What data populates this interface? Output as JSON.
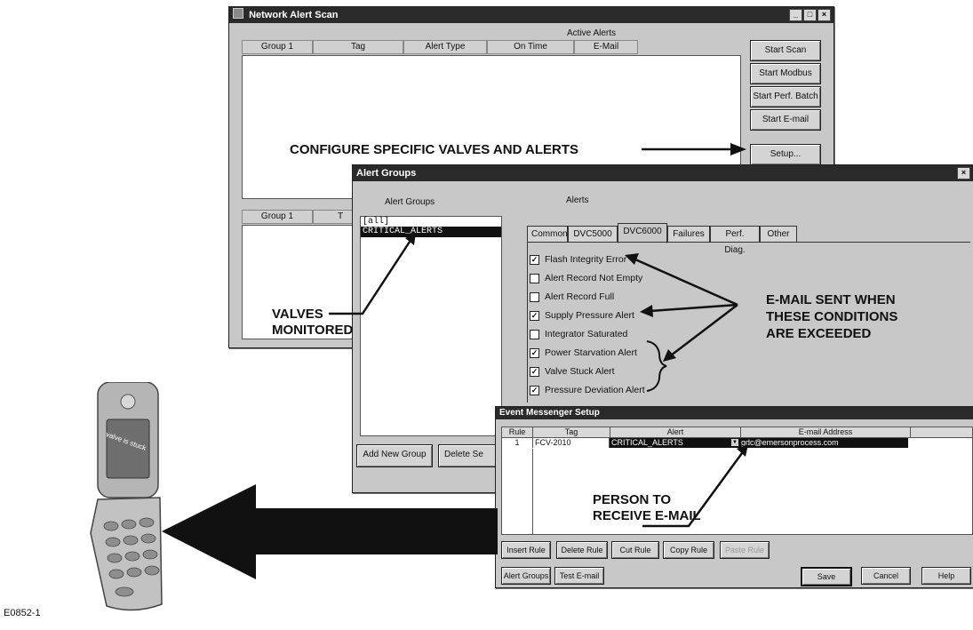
{
  "network_window": {
    "title": "Network Alert Scan",
    "section_title": "Active Alerts",
    "columns": [
      "Group 1",
      "Tag",
      "Alert Type",
      "On Time",
      "E-Mail"
    ],
    "lower_columns": [
      "Group 1",
      "T"
    ],
    "buttons": {
      "start_scan": "Start Scan",
      "start_modbus": "Start Modbus",
      "start_perf_batch": "Start Perf. Batch",
      "start_email": "Start E-mail",
      "setup": "Setup..."
    }
  },
  "alert_groups_window": {
    "title": "Alert Groups",
    "groups_label": "Alert Groups",
    "alerts_label": "Alerts",
    "groups": [
      "[all]",
      "CRITICAL_ALERTS"
    ],
    "tabs": [
      "Common",
      "DVC5000",
      "DVC6000",
      "Failures",
      "Perf. Diag.",
      "Other"
    ],
    "active_tab": "DVC6000",
    "alerts": [
      {
        "label": "Flash Integrity Error",
        "checked": true
      },
      {
        "label": "Alert Record Not Empty",
        "checked": false
      },
      {
        "label": "Alert Record Full",
        "checked": false
      },
      {
        "label": "Supply Pressure Alert",
        "checked": true
      },
      {
        "label": "Integrator Saturated",
        "checked": false
      },
      {
        "label": "Power Starvation Alert",
        "checked": true
      },
      {
        "label": "Valve Stuck Alert",
        "checked": true
      },
      {
        "label": "Pressure Deviation Alert",
        "checked": true
      }
    ],
    "buttons": {
      "add_group": "Add New Group",
      "delete_group": "Delete Se"
    }
  },
  "event_window": {
    "title": "Event Messenger Setup",
    "columns": [
      "Rule",
      "Tag",
      "Alert",
      "E-mail Address"
    ],
    "row": {
      "rule": "1",
      "tag": "FCV-2010",
      "alert": "CRITICAL_ALERTS",
      "email": "gdc@emersonprocess.com"
    },
    "buttons": {
      "insert": "Insert Rule",
      "delete": "Delete Rule",
      "cut": "Cut Rule",
      "copy": "Copy Rule",
      "paste": "Paste Rule",
      "alert_groups": "Alert Groups",
      "test_email": "Test E-mail",
      "save": "Save",
      "cancel": "Cancel",
      "help": "Help"
    }
  },
  "annotations": {
    "configure": "CONFIGURE SPECIFIC VALVES AND ALERTS",
    "valves_1": "VALVES",
    "valves_2": "MONITORED",
    "email_1": "E-MAIL SENT WHEN",
    "email_2": "THESE CONDITIONS",
    "email_3": "ARE EXCEEDED",
    "person_1": "PERSON TO",
    "person_2": "RECEIVE E-MAIL"
  },
  "phone": {
    "screen_text": "valve is stuck"
  },
  "figure_id": "E0852-1"
}
